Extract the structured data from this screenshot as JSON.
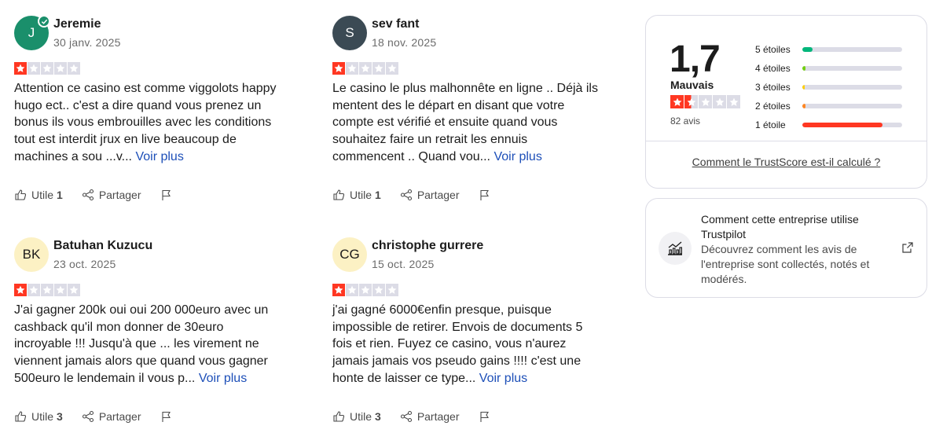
{
  "reviews": [
    {
      "name": "Jeremie",
      "date": "30 janv. 2025",
      "initials": "J",
      "avatar_bg": "#1a8f6b",
      "avatar_fg": "#ffffff",
      "verified": true,
      "rating": 1,
      "text": "Attention ce casino est comme viggolots happy hugo ect.. c'est a dire quand vous prenez un bonus ils vous embrouilles avec les conditions tout est interdit jrux en live beaucoup de machines a sou ...v...",
      "read_more": "Voir plus",
      "useful_label": "Utile",
      "useful_count": "1",
      "share_label": "Partager"
    },
    {
      "name": "sev fant",
      "date": "18 nov. 2025",
      "initials": "S",
      "avatar_bg": "#3b4a54",
      "avatar_fg": "#ffffff",
      "verified": false,
      "rating": 1,
      "text": "Le casino le plus malhonnête en ligne .. Déjà ils mentent des le départ en disant que votre compte est vérifié et ensuite quand vous souhaitez faire un retrait les ennuis commencent .. Quand vou...",
      "read_more": "Voir plus",
      "useful_label": "Utile",
      "useful_count": "1",
      "share_label": "Partager"
    },
    {
      "name": "Batuhan Kuzucu",
      "date": "23 oct. 2025",
      "initials": "BK",
      "avatar_bg": "#fcf1c4",
      "avatar_fg": "#1c1c1c",
      "verified": false,
      "rating": 1,
      "text": "J'ai gagner 200k oui oui 200 000euro avec un cashback qu'il mon donner de 30euro incroyable !!! Jusqu'à que ... les virement ne viennent jamais alors que quand vous gagner 500euro le lendemain il vous p...",
      "read_more": "Voir plus",
      "useful_label": "Utile",
      "useful_count": "3",
      "share_label": "Partager"
    },
    {
      "name": "christophe gurrere",
      "date": "15 oct. 2025",
      "initials": "CG",
      "avatar_bg": "#fcf1c4",
      "avatar_fg": "#1c1c1c",
      "verified": false,
      "rating": 1,
      "text": "j'ai gagné 6000€enfin presque, puisque impossible de retirer. Envois de documents 5 fois et rien. Fuyez ce casino, vous n'aurez jamais jamais vos pseudo gains !!!! c'est une honte de laisser ce type...",
      "read_more": "Voir plus",
      "useful_label": "Utile",
      "useful_count": "3",
      "share_label": "Partager"
    }
  ],
  "summary": {
    "score": "1,7",
    "label": "Mauvais",
    "stars_value": 1.5,
    "count_text": "82 avis",
    "distribution": [
      {
        "label": "5 étoiles",
        "percent": 10,
        "color": "#00b67a"
      },
      {
        "label": "4 étoiles",
        "percent": 3,
        "color": "#73cf11"
      },
      {
        "label": "3 étoiles",
        "percent": 2,
        "color": "#ffce00"
      },
      {
        "label": "2 étoiles",
        "percent": 3,
        "color": "#ff8622"
      },
      {
        "label": "1 étoile",
        "percent": 80,
        "color": "#ff3722"
      }
    ],
    "calc_link": "Comment le TrustScore est-il calculé ?"
  },
  "usage": {
    "title": "Comment cette entreprise utilise Trustpilot",
    "description": "Découvrez comment les avis de l'entreprise sont collectés, notés et modérés."
  },
  "colors": {
    "star_red": "#ff3722",
    "star_empty": "#dcdce6",
    "link_blue": "#1d4fb8"
  }
}
